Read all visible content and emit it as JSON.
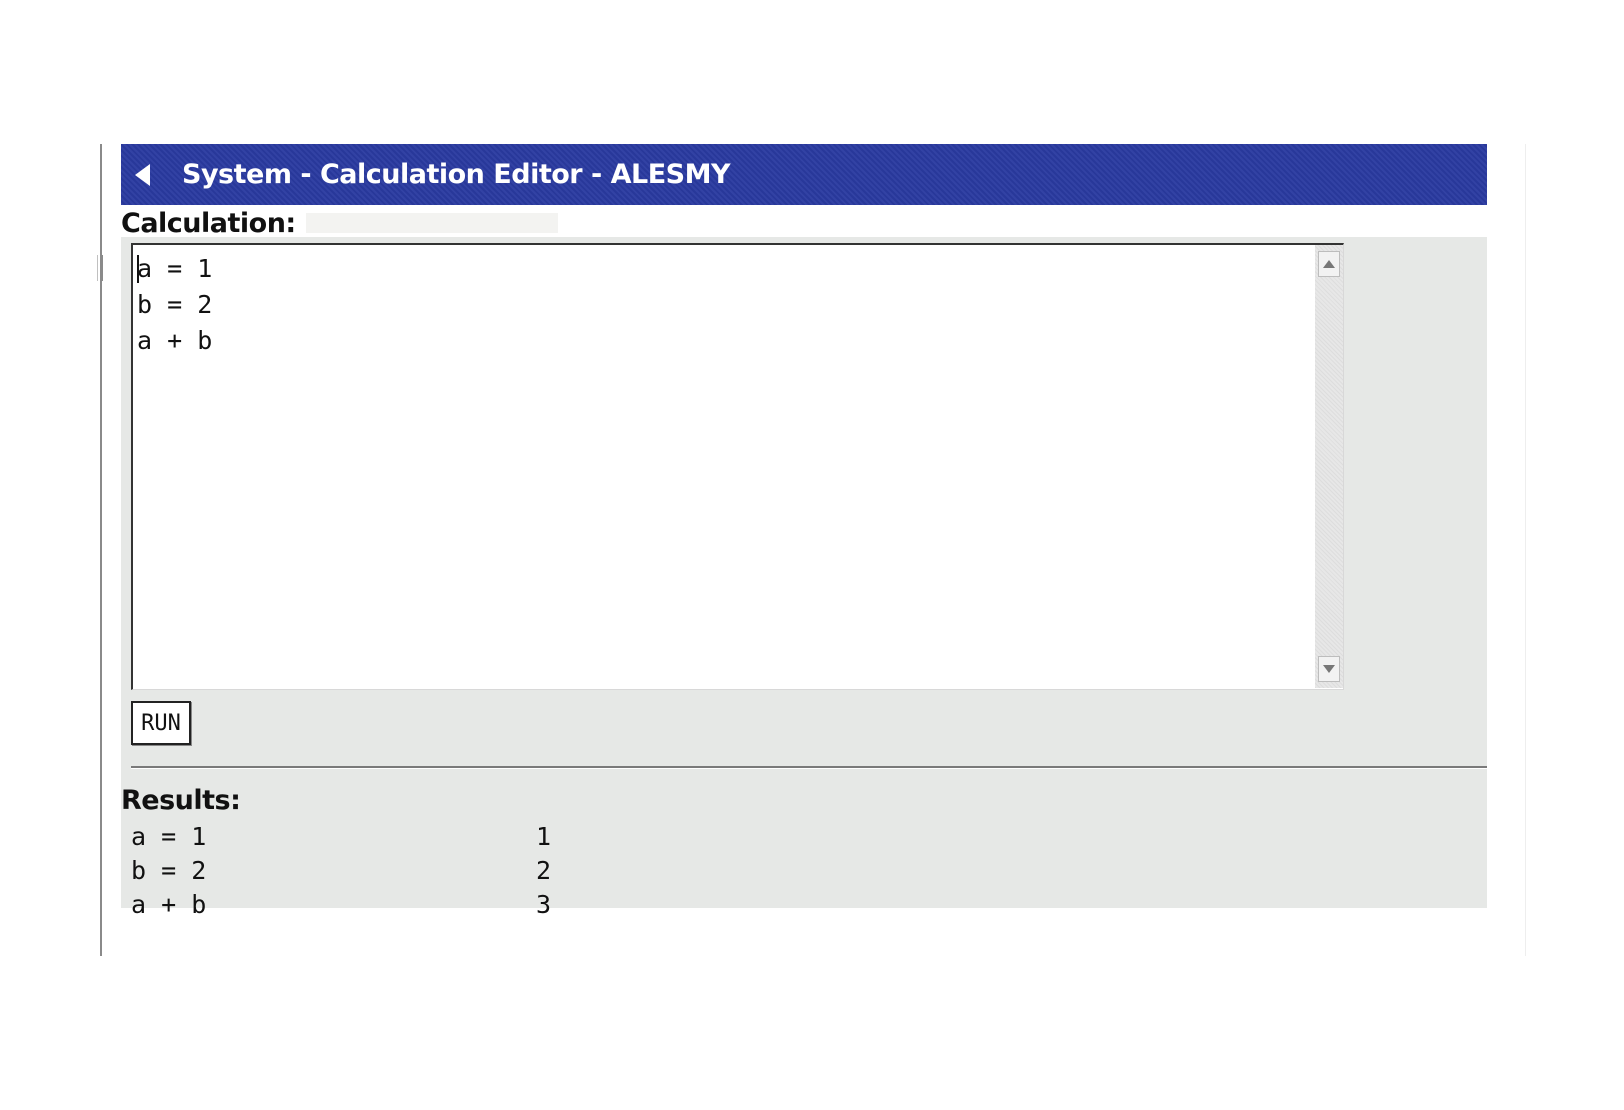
{
  "window": {
    "title": "System - Calculation Editor - ALESMY"
  },
  "calculation": {
    "label": "Calculation:",
    "name_value": "",
    "editor_text": "a = 1\nb = 2\na + b"
  },
  "toolbar": {
    "run_label": "RUN"
  },
  "results": {
    "label": "Results:",
    "rows": [
      {
        "expression": "a = 1",
        "value": "1"
      },
      {
        "expression": "b = 2",
        "value": "2"
      },
      {
        "expression": "a + b",
        "value": "3"
      }
    ]
  },
  "colors": {
    "titlebar": "#2a3aa0",
    "panel": "#e6e8e6"
  },
  "icons": {
    "back": "back-arrow-icon",
    "scroll_up": "scroll-up-arrow-icon",
    "scroll_down": "scroll-down-arrow-icon"
  }
}
